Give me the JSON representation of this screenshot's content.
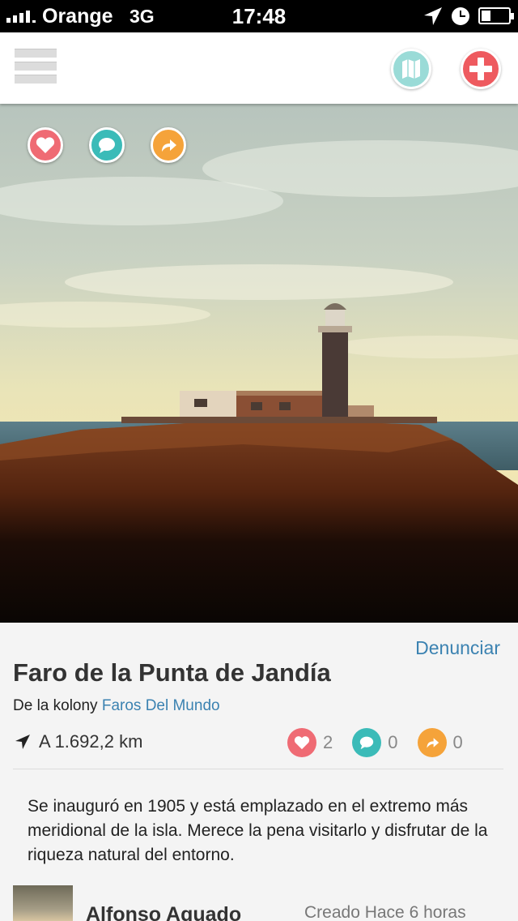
{
  "status_bar": {
    "carrier": "Orange",
    "network": "3G",
    "time": "17:48"
  },
  "nav": {
    "menu_icon": "hamburger-menu-icon",
    "map_icon": "map-icon",
    "add_icon": "plus-icon"
  },
  "photo": {
    "subject": "lighthouse-photo",
    "actions": [
      {
        "icon": "heart-icon",
        "color": "#ef6b74"
      },
      {
        "icon": "comment-icon",
        "color": "#3bbbb8"
      },
      {
        "icon": "share-icon",
        "color": "#f5a33a"
      }
    ]
  },
  "details": {
    "report_label": "Denunciar",
    "title": "Faro de la Punta de Jandía",
    "kolony_prefix": "De la kolony",
    "kolony_name": "Faros Del Mundo",
    "distance": "A 1.692,2 km",
    "likes": "2",
    "comments": "0",
    "shares": "0",
    "description": "Se inauguró en 1905 y está emplazado en el extremo más meridional de la isla. Merece la pena visitarlo y disfrutar de la riqueza natural del entorno.",
    "author": "Alfonso Aguado",
    "created": "Creado Hace 6 horas"
  },
  "colors": {
    "accent_link": "#3b82b1",
    "like": "#ef6b74",
    "comment": "#3bbbb8",
    "share": "#f5a33a",
    "map": "#9adbd7",
    "add": "#ee5a5f"
  }
}
